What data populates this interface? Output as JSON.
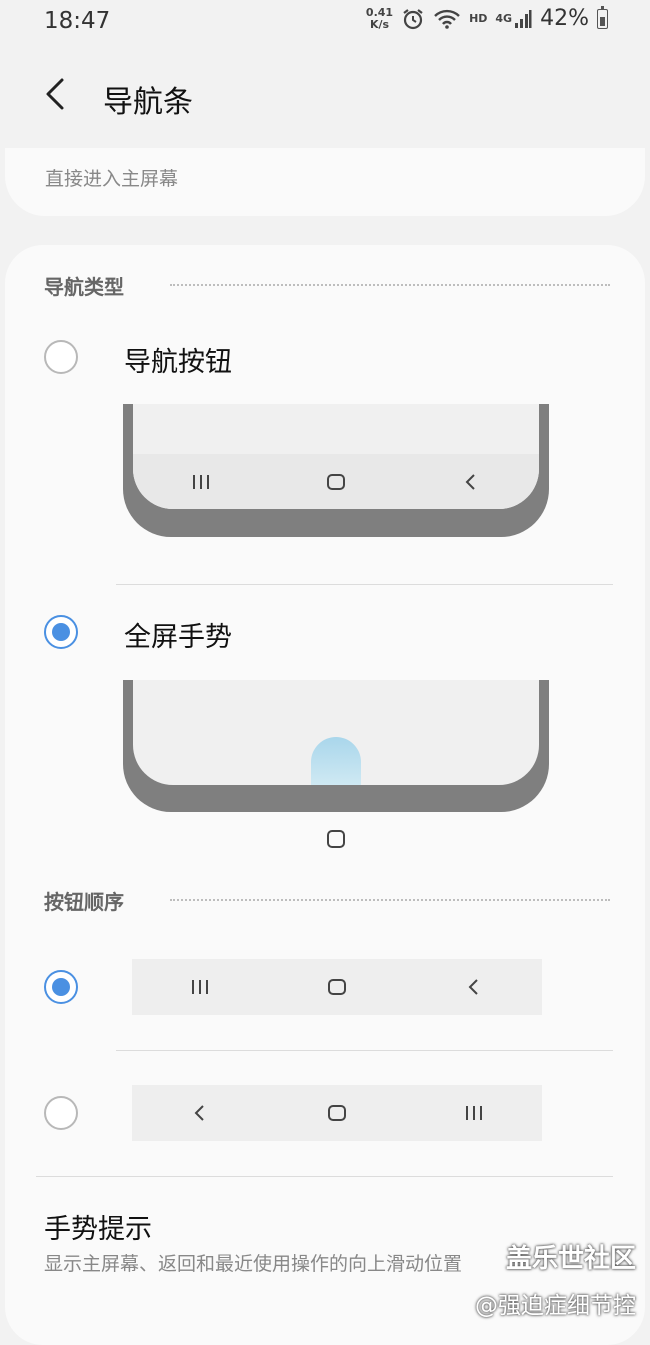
{
  "status_bar": {
    "time": "18:47",
    "net_speed_value": "0.41",
    "net_speed_unit": "K/s",
    "hd_label": "HD",
    "signal_label": "4G",
    "battery_percent": "42%"
  },
  "header": {
    "title": "导航条"
  },
  "top_card": {
    "text": "直接进入主屏幕"
  },
  "nav_type": {
    "section_title": "导航类型",
    "options": [
      {
        "label": "导航按钮",
        "selected": false
      },
      {
        "label": "全屏手势",
        "selected": true
      }
    ]
  },
  "button_order": {
    "section_title": "按钮顺序",
    "options": [
      {
        "order": [
          "recents-icon",
          "home-icon",
          "back-icon"
        ],
        "selected": true
      },
      {
        "order": [
          "back-icon",
          "home-icon",
          "recents-icon"
        ],
        "selected": false
      }
    ]
  },
  "gesture_hint": {
    "title": "手势提示",
    "description": "显示主屏幕、返回和最近使用操作的向上滑动位置"
  },
  "watermark": {
    "line1": "盖乐世社区",
    "line2": "@强迫症细节控"
  },
  "colors": {
    "accent": "#4a90e2",
    "pill": "#a9d6eb",
    "phone_frame": "#7f7f7f"
  }
}
